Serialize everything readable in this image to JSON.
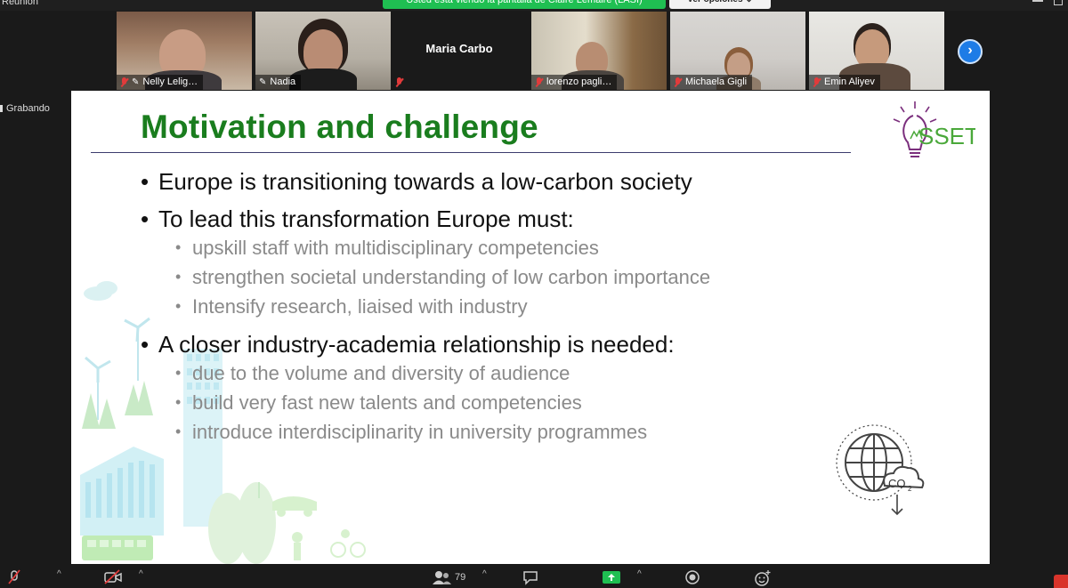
{
  "window": {
    "title": "Reunión"
  },
  "share": {
    "banner": "Usted está viendo la pantalla de Claire Lemaire (LASI)",
    "view_options": "Ver opciones ⌄"
  },
  "participants": [
    {
      "name": "Nelly Lelig…"
    },
    {
      "name": "Nadia"
    },
    {
      "name": "Maria Carbo"
    },
    {
      "name": "lorenzo pagli…"
    },
    {
      "name": "Michaela Gigli"
    },
    {
      "name": "Emin Aliyev"
    }
  ],
  "recording": {
    "label": "Grabando"
  },
  "slide": {
    "title": "Motivation and challenge",
    "logo_text": "ASSET",
    "co2_label": "CO",
    "co2_sub": "2",
    "bullet1": "Europe is transitioning towards a low-carbon society",
    "bullet2": "To lead this transformation Europe must:",
    "bullet2_subs": [
      "upskill staff with multidisciplinary competencies",
      "strengthen societal understanding of low carbon importance",
      "Intensify research, liaised with industry"
    ],
    "bullet3": "A closer industry-academia relationship is needed:",
    "bullet3_subs": [
      "due to the volume and diversity of audience",
      "build very fast new talents and competencies",
      "introduce interdisciplinarity in university programmes"
    ]
  },
  "toolbar": {
    "participants_count": "79"
  },
  "colors": {
    "title_green": "#1a7d1e",
    "banner_green": "#1fbf52",
    "accent_blue": "#1e7ce6",
    "mute_red": "#e23b3b"
  }
}
